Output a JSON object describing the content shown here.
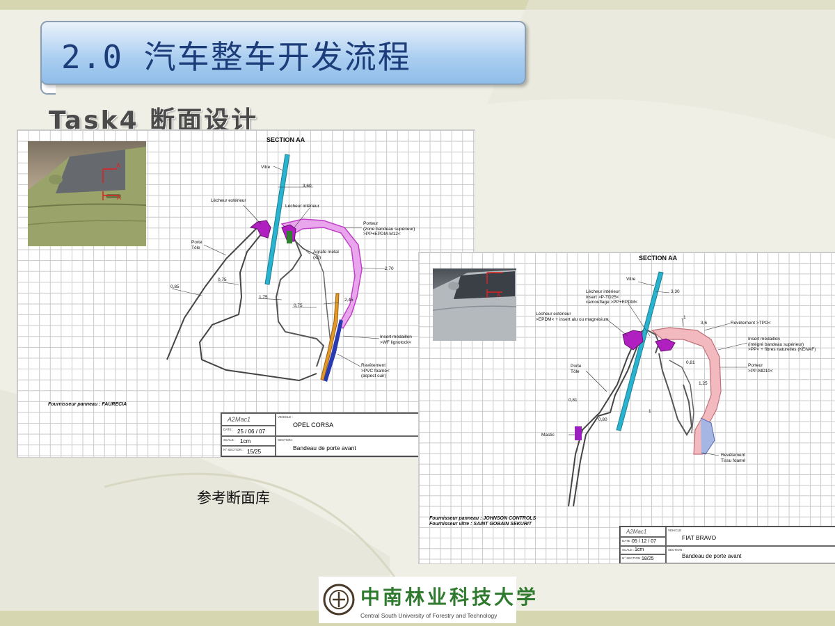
{
  "slide": {
    "title": "2.0  汽车整车开发流程",
    "subtitle": "Task4  断面设计",
    "caption": "参考断面库"
  },
  "drawing1": {
    "section_title": "SECTION AA",
    "photo_marker": "A",
    "labels": {
      "vitre": "Vitre",
      "lecheur_ext": "Lécheur extérieur",
      "lecheur_int": "Lécheur intérieur",
      "porteur": "Porteur\n(zone bandeau supérieur)\n>PP+EPDM-M12<",
      "porte": "Porte\nTôle",
      "agrafe": "Agrafe métal\n(x3)",
      "insert": "Insert médaillon\n>WF lignotock<",
      "revetement": "Revêtement\n>PVC foamé<\n(aspect cuir)"
    },
    "dims": [
      "3,60",
      "0,85",
      "0,75",
      "1,75",
      "0,75",
      "2,45",
      "2,70"
    ],
    "supplier": "Fournisseur panneau : FAURECIA",
    "title_block": {
      "logo": "A2Mac1",
      "vehicle_label": "VEHICLE :",
      "vehicle": "OPEL CORSA",
      "date_label": "DATE :",
      "date": "25 / 06 / 07",
      "scale_label": "SCALE :",
      "scale": "1cm",
      "section_label": "SECTION :",
      "section": "Bandeau de porte avant",
      "nsection_label": "N° SECTION :",
      "nsection": "15/25"
    }
  },
  "drawing2": {
    "section_title": "SECTION AA",
    "photo_marker": "A",
    "labels": {
      "vitre": "Vitre",
      "lecheur_int": "Lécheur intérieur\ninsert >P-TD25<\ncamouflage >PP+EPDM<",
      "lecheur_ext": "Lécheur extérieur\n>EPDM< + insert alu ou magnésium",
      "revetement_top": "Revêtement >TPO<",
      "insert": "Insert médaillon\n(intégré bandeau supérieur)\n>PP< + fibres naturelles (KENAF)",
      "porteur": "Porteur\n>PP-MD10<",
      "porte": "Porte\nTôle",
      "mastic": "Mastic",
      "revetement_bottom": "Revêtement\nTissu foamé"
    },
    "dims": [
      "3,30",
      "1",
      "3,6",
      "0,81",
      "1,25",
      "0,81",
      "0,80",
      "1"
    ],
    "supplier": "Fournisseur panneau : JOHNSON CONTROLS\nFournisseur vitre : SAINT GOBAIN SEKURIT",
    "title_block": {
      "logo": "A2Mac1",
      "vehicle_label": "VEHICLE",
      "vehicle": "FIAT BRAVO",
      "date_label": "DATE :",
      "date": "05 / 12 / 07",
      "scale_label": "SCALE :",
      "scale": "1cm",
      "section_label": "SECTION :",
      "section": "Bandeau de porte avant",
      "nsection_label": "N° SECTION :",
      "nsection": "18/25"
    }
  },
  "logo": {
    "cn": "中南林业科技大学",
    "en": "Central South University of Forestry and Technology"
  },
  "colors": {
    "title_text": "#1d3d7a",
    "glass": "#29b3cf",
    "seal": "#b020c0",
    "carrier": "#e070e0",
    "insert": "#e49a2a",
    "trim": "#2a3ab0",
    "logo_green": "#2f7a2f"
  }
}
